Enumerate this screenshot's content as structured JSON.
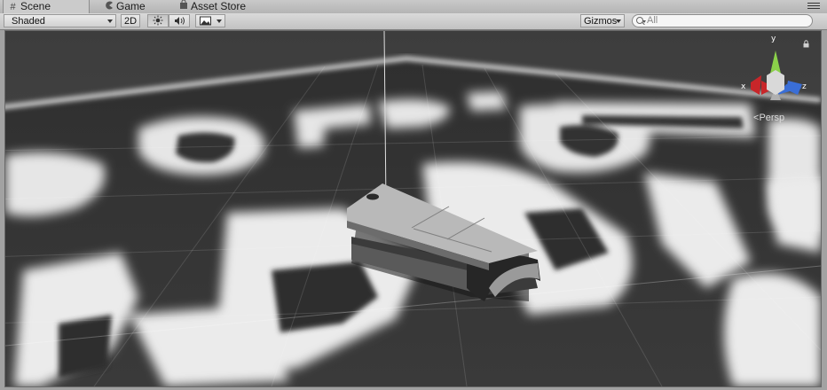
{
  "tabs": [
    {
      "label": "Scene",
      "icon": "grid-icon",
      "active": true
    },
    {
      "label": "Game",
      "icon": "pacman-icon",
      "active": false
    },
    {
      "label": "Asset Store",
      "icon": "shopping-bag-icon",
      "active": false
    }
  ],
  "toolbar": {
    "draw_mode": "Shaded",
    "mode_2d": "2D",
    "lighting_icon": "sun-icon",
    "audio_icon": "speaker-icon",
    "effects_icon": "image-icon",
    "gizmos_label": "Gizmos",
    "search_placeholder": "All"
  },
  "scene": {
    "gizmo_axes": {
      "y": "y",
      "x": "x",
      "z": "z"
    },
    "projection_label": "Persp",
    "lock_icon": "lock-icon",
    "axis_colors": {
      "x": "#c8262a",
      "y": "#8bd14a",
      "z": "#3a6ed6"
    }
  }
}
